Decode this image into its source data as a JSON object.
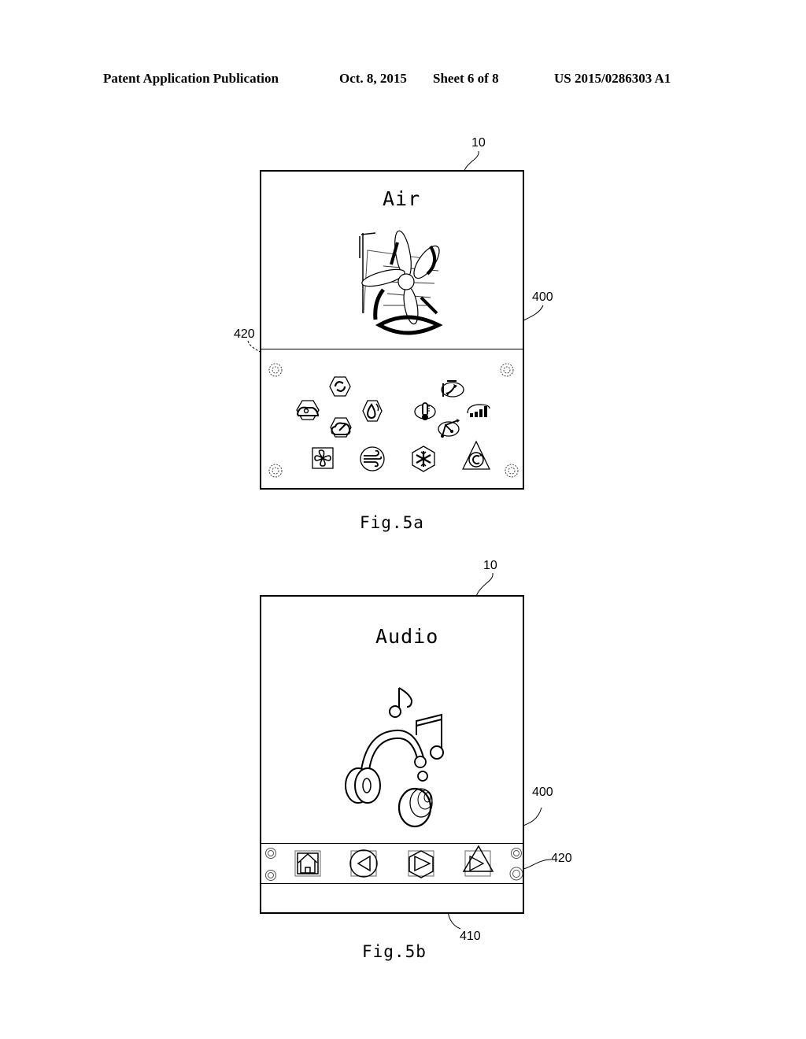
{
  "header": {
    "publication": "Patent Application Publication",
    "date": "Oct. 8, 2015",
    "sheet": "Sheet 6 of 8",
    "number": "US 2015/0286303 A1"
  },
  "fig5a": {
    "caption": "Fig.5a",
    "screen_title": "Air",
    "ref_device": "10",
    "ref_panel": "400",
    "ref_sensor": "420",
    "main_icon": "fan-icon",
    "icons": [
      {
        "name": "recycle-hex-icon"
      },
      {
        "name": "car-hex-icon"
      },
      {
        "name": "water-drop-hex-icon"
      },
      {
        "name": "cloud-gauge-hex-icon"
      },
      {
        "name": "rotate-oval-icon"
      },
      {
        "name": "thermometer-oval-icon"
      },
      {
        "name": "signal-bars-oval-icon"
      },
      {
        "name": "direction-oval-icon"
      },
      {
        "name": "fan-square-icon"
      },
      {
        "name": "wind-circle-icon"
      },
      {
        "name": "snowflake-hex-icon"
      },
      {
        "name": "celsius-triangle-icon"
      }
    ]
  },
  "fig5b": {
    "caption": "Fig.5b",
    "screen_title": "Audio",
    "ref_device": "10",
    "ref_panel": "400",
    "ref_buttons": "410",
    "ref_sensor": "420",
    "main_icon": "headphones-music-icon",
    "buttons": [
      {
        "name": "home-button"
      },
      {
        "name": "previous-button"
      },
      {
        "name": "play-button"
      },
      {
        "name": "next-button"
      }
    ]
  }
}
